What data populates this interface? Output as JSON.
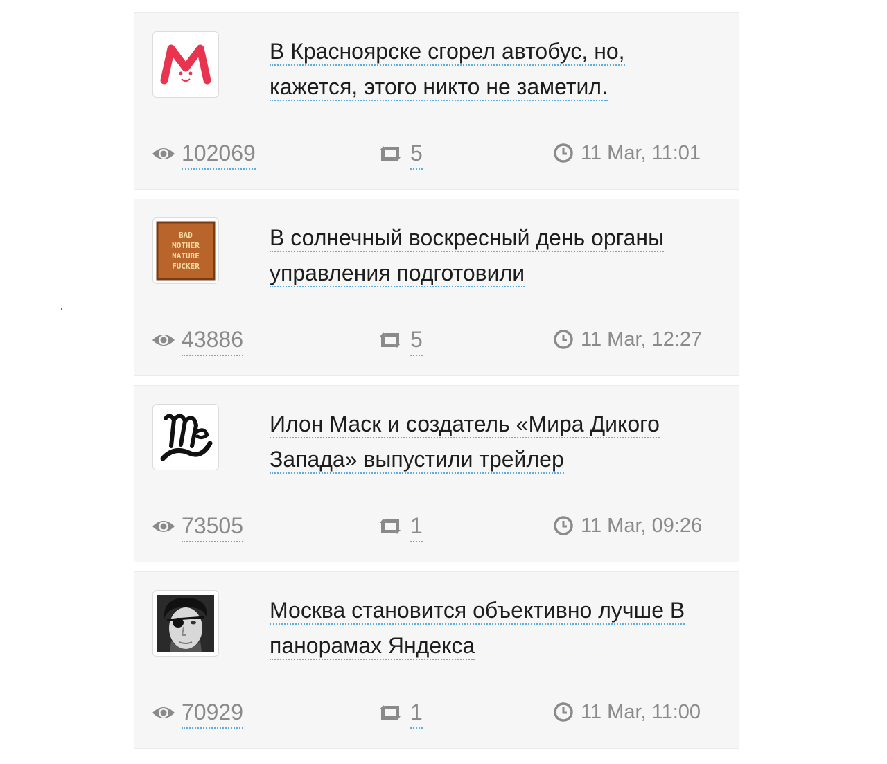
{
  "posts": [
    {
      "avatar": "meduza-logo-icon",
      "title": "В Красноярске сгорел автобус, но, кажется, этого никто не заметил.",
      "views": "102069",
      "reposts": "5",
      "time": "11 Mar, 11:01"
    },
    {
      "avatar": "bad-mother-nature-poster-icon",
      "avatar_text": "BAD MOTHER NATURE FUCKER",
      "title": "В солнечный воскресный день органы управления подготовили",
      "views": "43886",
      "reposts": "5",
      "time": "11 Mar, 12:27"
    },
    {
      "avatar": "mak-script-logo-icon",
      "avatar_text": "Мак",
      "title": "Илон Маск и создатель «Мира Дикого Запада» выпустили трейлер",
      "views": "73505",
      "reposts": "1",
      "time": "11 Mar, 09:26"
    },
    {
      "avatar": "user-photo-eyepatch-icon",
      "title": "Москва становится объективно лучше В панорамах Яндекса",
      "views": "70929",
      "reposts": "1",
      "time": "11 Mar, 11:00"
    }
  ],
  "colors": {
    "card_bg": "#f6f6f6",
    "link_underline": "#5aaee0",
    "meta_text": "#8a8a8a",
    "meduza_red": "#e8344e"
  }
}
